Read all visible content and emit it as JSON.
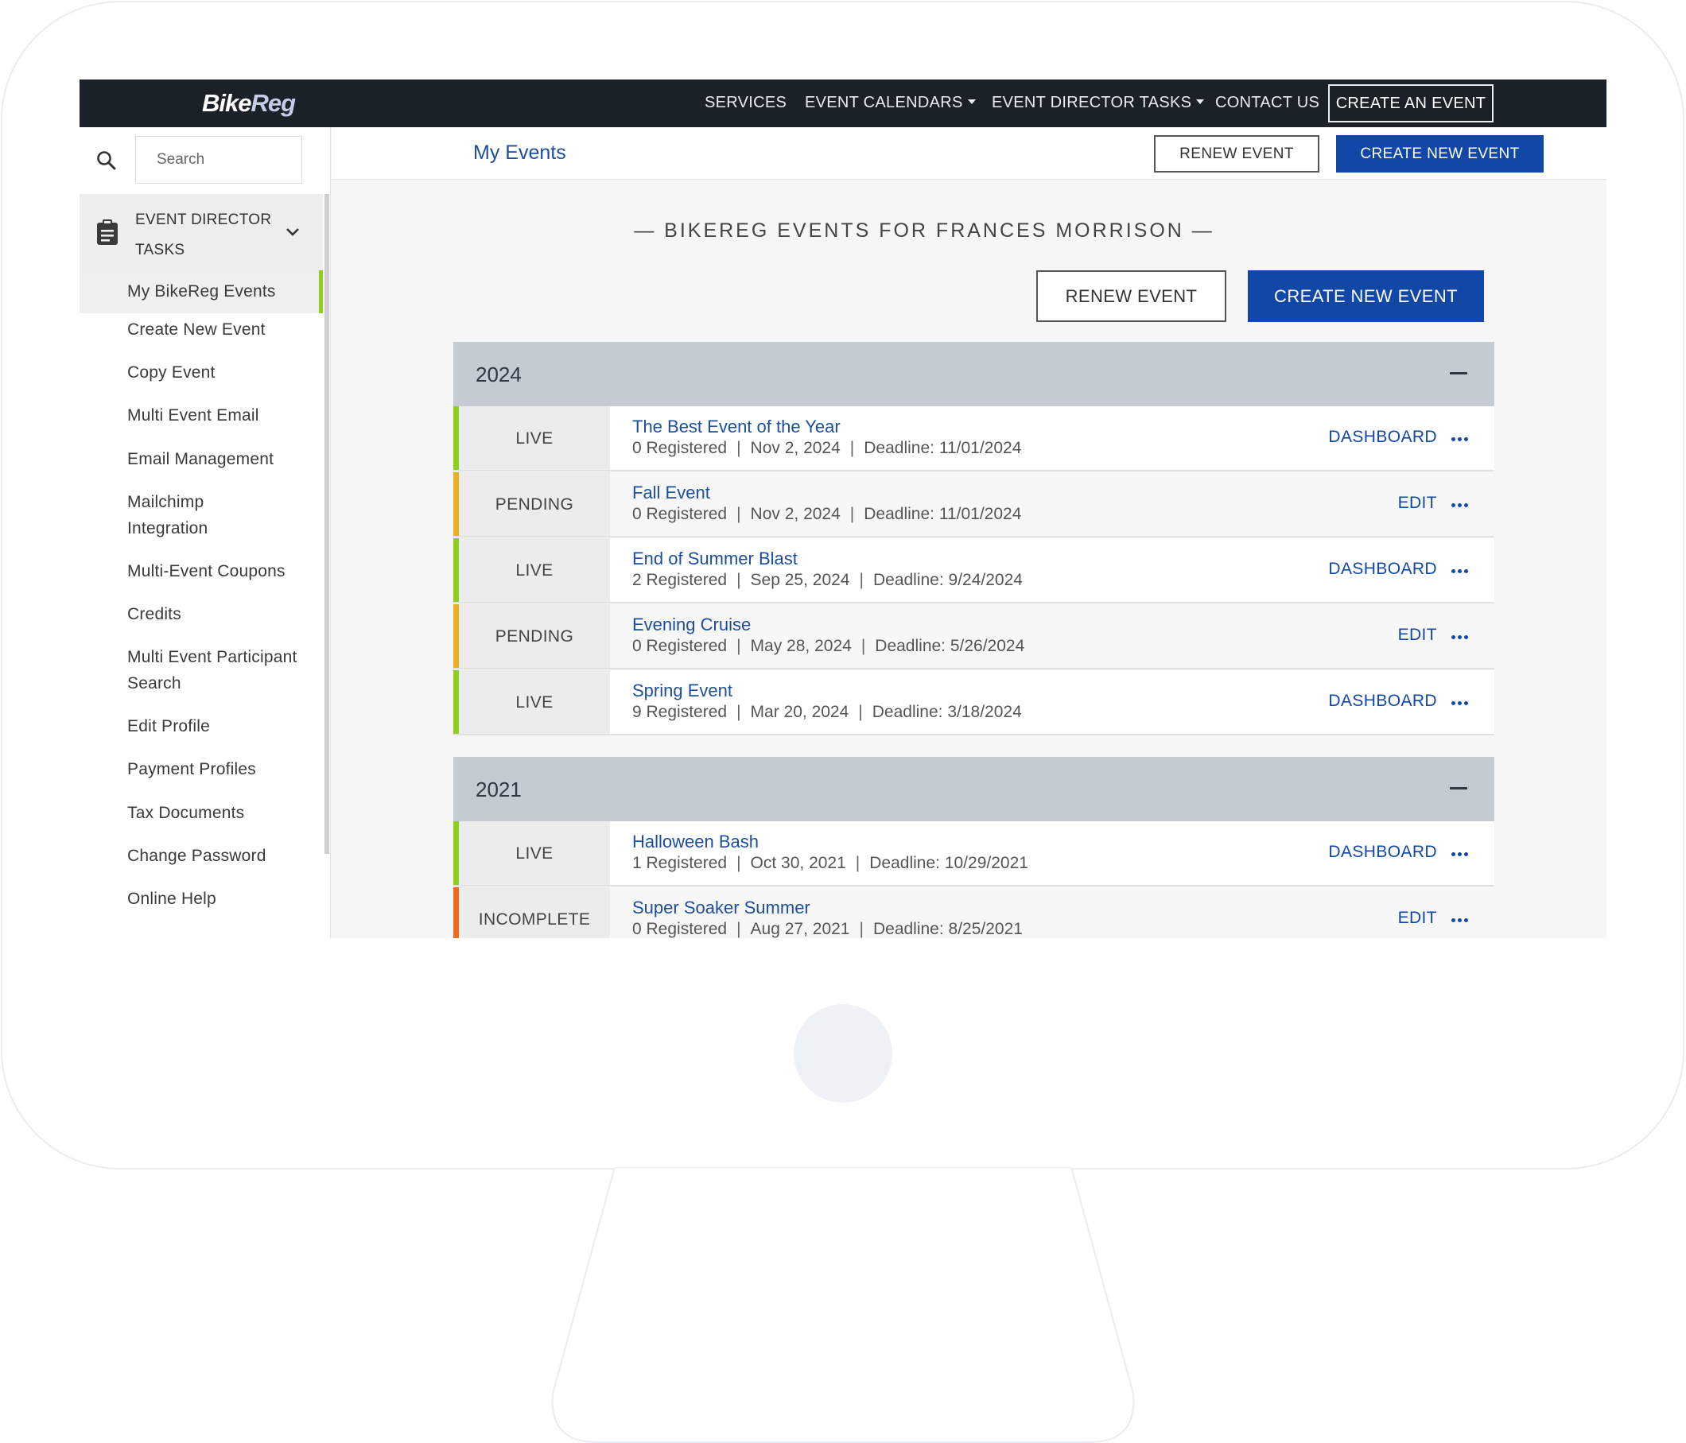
{
  "brand": {
    "logo_part1": "Bike",
    "logo_part2": "Reg"
  },
  "topnav": {
    "services": "SERVICES",
    "event_calendars": "EVENT CALENDARS",
    "event_director_tasks": "EVENT DIRECTOR TASKS",
    "contact_us": "CONTACT US",
    "create_an_event": "CREATE AN EVENT"
  },
  "sidebar": {
    "search_placeholder": "Search",
    "section_label": "EVENT DIRECTOR TASKS",
    "items": [
      {
        "label": "My BikeReg Events",
        "active": true
      },
      {
        "label": "Create New Event"
      },
      {
        "label": "Copy Event"
      },
      {
        "label": "Multi Event Email"
      },
      {
        "label": "Email Management"
      },
      {
        "label": "Mailchimp Integration"
      },
      {
        "label": "Multi-Event Coupons"
      },
      {
        "label": "Credits"
      },
      {
        "label": "Multi Event Participant Search"
      },
      {
        "label": "Edit Profile"
      },
      {
        "label": "Payment Profiles"
      },
      {
        "label": "Tax Documents"
      },
      {
        "label": "Change Password"
      },
      {
        "label": "Online Help"
      }
    ]
  },
  "header": {
    "title": "My Events",
    "renew_label": "RENEW EVENT",
    "create_label": "CREATE NEW EVENT"
  },
  "main": {
    "heading": "— BIKEREG EVENTS FOR FRANCES MORRISON —",
    "renew_label": "RENEW EVENT",
    "create_label": "CREATE NEW EVENT",
    "years": [
      {
        "year": "2024",
        "events": [
          {
            "status": "LIVE",
            "name": "The Best Event of the Year",
            "registered": "0 Registered",
            "date": "Nov 2, 2024",
            "deadline": "Deadline: 11/01/2024",
            "action": "DASHBOARD"
          },
          {
            "status": "PENDING",
            "name": "Fall Event",
            "registered": "0 Registered",
            "date": "Nov 2, 2024",
            "deadline": "Deadline: 11/01/2024",
            "action": "EDIT"
          },
          {
            "status": "LIVE",
            "name": "End of Summer Blast",
            "registered": "2 Registered",
            "date": "Sep 25, 2024",
            "deadline": "Deadline: 9/24/2024",
            "action": "DASHBOARD"
          },
          {
            "status": "PENDING",
            "name": "Evening Cruise",
            "registered": "0 Registered",
            "date": "May 28, 2024",
            "deadline": "Deadline: 5/26/2024",
            "action": "EDIT"
          },
          {
            "status": "LIVE",
            "name": "Spring Event",
            "registered": "9 Registered",
            "date": "Mar 20, 2024",
            "deadline": "Deadline: 3/18/2024",
            "action": "DASHBOARD"
          }
        ]
      },
      {
        "year": "2021",
        "events": [
          {
            "status": "LIVE",
            "name": "Halloween Bash",
            "registered": "1 Registered",
            "date": "Oct 30, 2021",
            "deadline": "Deadline: 10/29/2021",
            "action": "DASHBOARD"
          },
          {
            "status": "INCOMPLETE",
            "name": "Super Soaker Summer",
            "registered": "0 Registered",
            "date": "Aug 27, 2021",
            "deadline": "Deadline: 8/25/2021",
            "action": "EDIT"
          }
        ]
      }
    ]
  },
  "colors": {
    "nav_bg": "#1a2128",
    "primary": "#1147a6",
    "link": "#1c4e9e",
    "status_live": "#8ed11d",
    "status_pending": "#e6b120",
    "status_incomplete": "#f26b1d",
    "year_header_bg": "#c4cbd3"
  }
}
